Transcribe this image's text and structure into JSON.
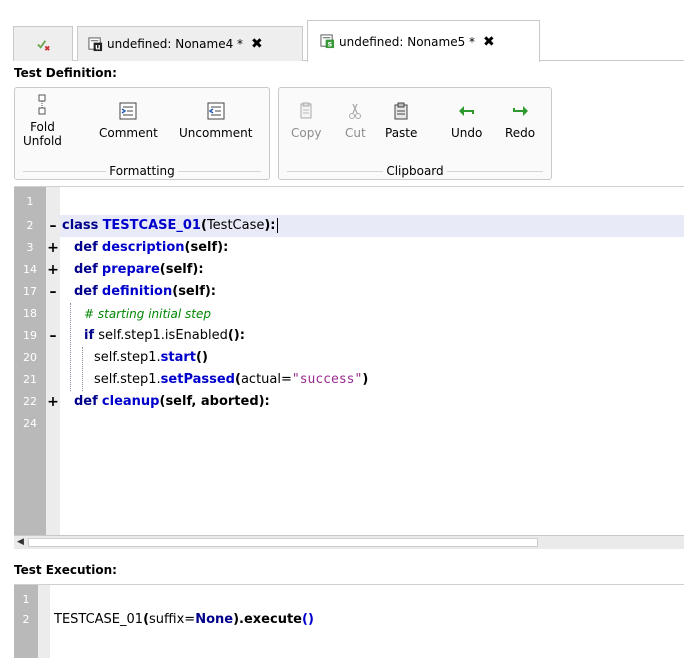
{
  "tabs": [
    {
      "label": "",
      "icon": "checklist-icon"
    },
    {
      "label": "undefined: Noname4 *",
      "icon": "document-u-icon"
    },
    {
      "label": "undefined: Noname5 *",
      "icon": "document-s-icon"
    }
  ],
  "tab_close_glyph": "✖",
  "sections": {
    "definition_title": "Test Definition:",
    "execution_title": "Test Execution:"
  },
  "ribbon": {
    "formatting": {
      "label": "Formatting",
      "buttons": {
        "fold_unfold": "Fold\nUnfold",
        "comment": "Comment",
        "uncomment": "Uncomment"
      }
    },
    "clipboard": {
      "label": "Clipboard",
      "buttons": {
        "copy": "Copy",
        "cut": "Cut",
        "paste": "Paste",
        "undo": "Undo",
        "redo": "Redo"
      }
    }
  },
  "editor": {
    "lines": [
      {
        "num": "1",
        "fold": ""
      },
      {
        "num": "2",
        "fold": "–"
      },
      {
        "num": "3",
        "fold": "+"
      },
      {
        "num": "14",
        "fold": "+"
      },
      {
        "num": "17",
        "fold": "–"
      },
      {
        "num": "18",
        "fold": ""
      },
      {
        "num": "19",
        "fold": "–"
      },
      {
        "num": "20",
        "fold": ""
      },
      {
        "num": "21",
        "fold": ""
      },
      {
        "num": "22",
        "fold": "+"
      },
      {
        "num": "24",
        "fold": ""
      }
    ],
    "code": {
      "l2_kw": "class",
      "l2_name": "TESTCASE_01",
      "l2_open": "(",
      "l2_arg": "TestCase",
      "l2_close": "):",
      "def": "def",
      "l3_name": "description",
      "l3_args": "(self):",
      "l14_name": "prepare",
      "l14_args": "(self):",
      "l17_name": "definition",
      "l17_args": "(self):",
      "l18_comment": "# starting initial step",
      "l19_kw": "if",
      "l19_text": "self.step1.isEnabled",
      "l19_paren": "():",
      "l20_text": "self.step1.",
      "l20_fn": "start",
      "l20_paren": "()",
      "l21_text": "self.step1.",
      "l21_fn": "setPassed",
      "l21_open": "(",
      "l21_arg": "actual=",
      "l21_str": "\"success\"",
      "l21_close": ")",
      "l22_name": "cleanup",
      "l22_args": "(self, aborted):"
    }
  },
  "execution": {
    "lines": [
      "1",
      "2"
    ],
    "code": {
      "name": "TESTCASE_01",
      "open": "(",
      "arg": "suffix=",
      "none_kw": "None",
      "close": ").execute",
      "call": "()"
    }
  },
  "colors": {
    "keyword": "#00008b",
    "function": "#0000cc",
    "comment": "#008800",
    "string": "#9b2d91",
    "gutter": "#b9b9b9",
    "current_line": "#e8eaf8"
  }
}
